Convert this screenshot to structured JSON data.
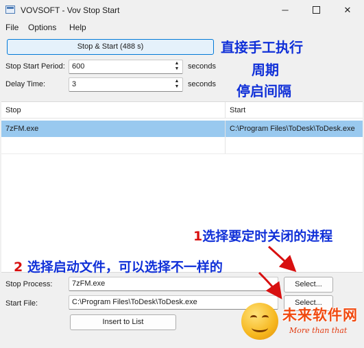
{
  "window": {
    "title": "VOVSOFT - Vov Stop Start",
    "minimize_glyph": "─",
    "close_glyph": "✕"
  },
  "menu": {
    "file": "File",
    "options": "Options",
    "help": "Help"
  },
  "stop_start_button": "Stop & Start (488 s)",
  "period": {
    "label": "Stop Start Period:",
    "value": "600",
    "unit": "seconds"
  },
  "delay": {
    "label": "Delay Time:",
    "value": "3",
    "unit": "seconds"
  },
  "list": {
    "columns": [
      "Stop",
      "Start"
    ],
    "rows": [
      {
        "stop": "7zFM.exe",
        "start": "C:\\Program Files\\ToDesk\\ToDesk.exe"
      }
    ]
  },
  "stop_process": {
    "label": "Stop Process:",
    "value": "7zFM.exe",
    "button": "Select..."
  },
  "start_file": {
    "label": "Start File:",
    "value": "C:\\Program Files\\ToDesk\\ToDesk.exe",
    "button": "Select..."
  },
  "insert_button": "Insert to List",
  "annotations": {
    "manual": "直接手工执行",
    "period": "周期",
    "delay": "停启间隔",
    "select_stop_num": "1",
    "select_stop_text": "选择要定时关闭的进程",
    "select_start_num": "2",
    "select_start_text": " 选择启动文件，可以选择不一样的"
  },
  "watermark": {
    "text": "未来软件网",
    "sub": "More than that"
  },
  "colors": {
    "annotation_blue": "#1030d8",
    "annotation_red": "#d81010",
    "selected_row": "#99c9ef",
    "accent": "#0078d7"
  }
}
